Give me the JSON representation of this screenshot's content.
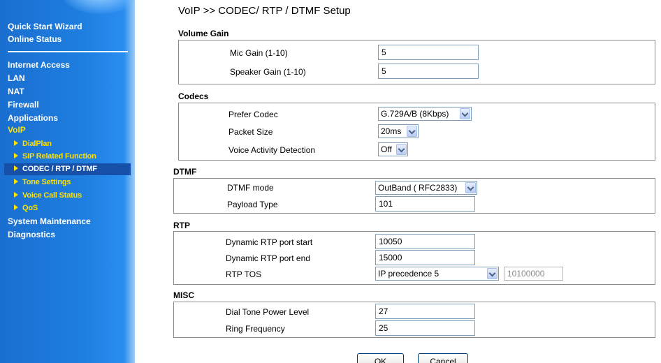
{
  "sidebar": {
    "items": [
      {
        "label": "Quick Start Wizard"
      },
      {
        "label": "Online Status"
      },
      {
        "label": "Internet Access"
      },
      {
        "label": "LAN"
      },
      {
        "label": "NAT"
      },
      {
        "label": "Firewall"
      },
      {
        "label": "Applications"
      },
      {
        "label": "VoIP"
      },
      {
        "label": "System Maintenance"
      },
      {
        "label": "Diagnostics"
      }
    ],
    "voip_sub": [
      {
        "label": "DialPlan"
      },
      {
        "label": "SIP Related Function"
      },
      {
        "label": "CODEC / RTP / DTMF"
      },
      {
        "label": "Tone Settings"
      },
      {
        "label": "Voice Call Status"
      },
      {
        "label": "QoS"
      }
    ]
  },
  "page_title": "VoIP >> CODEC/ RTP / DTMF Setup",
  "volume_gain": {
    "title": "Volume Gain",
    "mic_label": "Mic Gain (1-10)",
    "mic_value": "5",
    "speaker_label": "Speaker Gain (1-10)",
    "speaker_value": "5"
  },
  "codecs": {
    "title": "Codecs",
    "prefer_label": "Prefer Codec",
    "prefer_value": "G.729A/B (8Kbps)",
    "packet_label": "Packet Size",
    "packet_value": "20ms",
    "vad_label": "Voice Activity Detection",
    "vad_value": "Off"
  },
  "dtmf": {
    "title": "DTMF",
    "mode_label": "DTMF mode",
    "mode_value": "OutBand ( RFC2833)",
    "payload_label": "Payload Type",
    "payload_value": "101"
  },
  "rtp": {
    "title": "RTP",
    "start_label": "Dynamic RTP port start",
    "start_value": "10050",
    "end_label": "Dynamic RTP port end",
    "end_value": "15000",
    "tos_label": "RTP TOS",
    "tos_value": "IP precedence 5",
    "tos_bits": "10100000"
  },
  "misc": {
    "title": "MISC",
    "dial_label": "Dial Tone Power Level",
    "dial_value": "27",
    "ring_label": "Ring Frequency",
    "ring_value": "25"
  },
  "buttons": {
    "ok": "OK",
    "cancel": "Cancel"
  }
}
